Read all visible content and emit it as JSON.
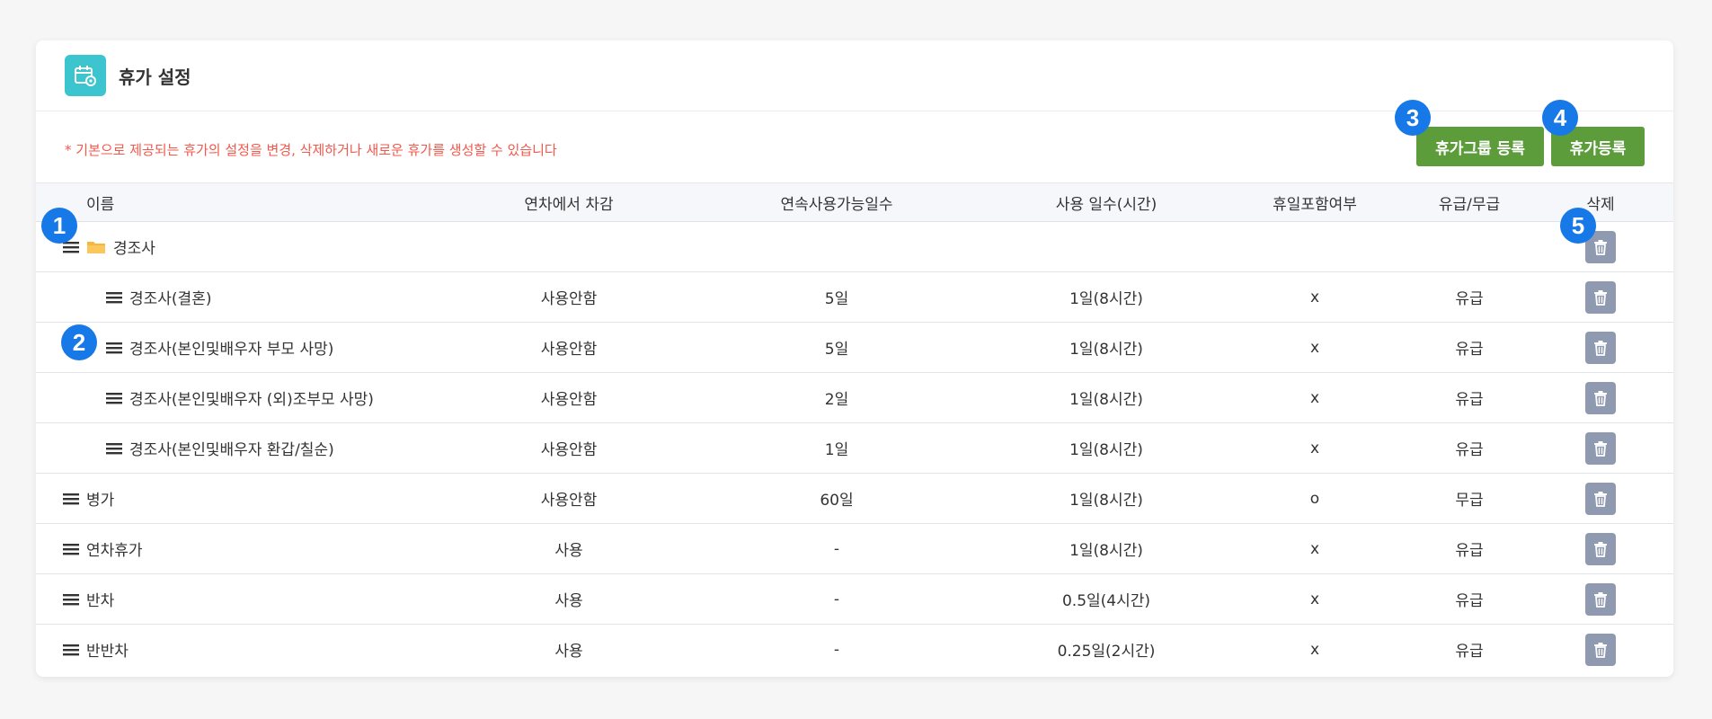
{
  "header": {
    "title": "휴가 설정",
    "icon": "calendar-gear-icon"
  },
  "notice": "* 기본으로 제공되는 휴가의 설정을 변경, 삭제하거나 새로운 휴가를 생성할 수 있습니다",
  "buttons": {
    "add_group": "휴가그룹 등록",
    "add_leave": "휴가등록"
  },
  "columns": [
    "이름",
    "연차에서 차감",
    "연속사용가능일수",
    "사용 일수(시간)",
    "휴일포함여부",
    "유급/무급",
    "삭제"
  ],
  "rows": [
    {
      "name": "경조사",
      "deduct": "",
      "consecutive": "",
      "days": "",
      "holiday": "",
      "paid": ""
    },
    {
      "name": "경조사(결혼)",
      "deduct": "사용안함",
      "consecutive": "5일",
      "days": "1일(8시간)",
      "holiday": "x",
      "paid": "유급"
    },
    {
      "name": "경조사(본인및배우자 부모 사망)",
      "deduct": "사용안함",
      "consecutive": "5일",
      "days": "1일(8시간)",
      "holiday": "x",
      "paid": "유급"
    },
    {
      "name": "경조사(본인및배우자 (외)조부모 사망)",
      "deduct": "사용안함",
      "consecutive": "2일",
      "days": "1일(8시간)",
      "holiday": "x",
      "paid": "유급"
    },
    {
      "name": "경조사(본인및배우자 환갑/칠순)",
      "deduct": "사용안함",
      "consecutive": "1일",
      "days": "1일(8시간)",
      "holiday": "x",
      "paid": "유급"
    },
    {
      "name": "병가",
      "deduct": "사용안함",
      "consecutive": "60일",
      "days": "1일(8시간)",
      "holiday": "o",
      "paid": "무급"
    },
    {
      "name": "연차휴가",
      "deduct": "사용",
      "consecutive": "-",
      "days": "1일(8시간)",
      "holiday": "x",
      "paid": "유급"
    },
    {
      "name": "반차",
      "deduct": "사용",
      "consecutive": "-",
      "days": "0.5일(4시간)",
      "holiday": "x",
      "paid": "유급"
    },
    {
      "name": "반반차",
      "deduct": "사용",
      "consecutive": "-",
      "days": "0.25일(2시간)",
      "holiday": "x",
      "paid": "유급"
    }
  ],
  "badges": [
    "1",
    "2",
    "3",
    "4",
    "5"
  ],
  "colors": {
    "accent_green": "#5d9c3b",
    "notice_red": "#f2584c",
    "badge_blue": "#1778e8",
    "delete_gray": "#8f9ab0",
    "header_teal": "#3cc4cf",
    "folder_orange": "#f6b73c"
  }
}
